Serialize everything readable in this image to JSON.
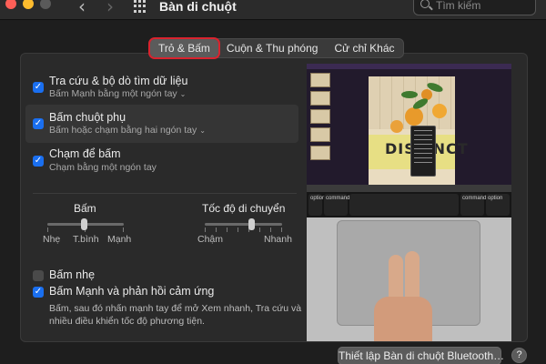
{
  "window": {
    "title": "Bàn di chuột",
    "back_icon": "‹",
    "forward_icon": "›"
  },
  "search": {
    "placeholder": "Tìm kiếm"
  },
  "tabs": [
    {
      "label": "Trỏ & Bấm",
      "active": true
    },
    {
      "label": "Cuộn & Thu phóng",
      "active": false
    },
    {
      "label": "Cử chỉ Khác",
      "active": false
    }
  ],
  "options": [
    {
      "label": "Tra cứu & bộ dò tìm dữ liệu",
      "sub": "Bấm Mạnh bằng một ngón tay",
      "has_menu": true,
      "checked": true
    },
    {
      "label": "Bấm chuột phụ",
      "sub": "Bấm hoặc chạm bằng hai ngón tay",
      "has_menu": true,
      "checked": true
    },
    {
      "label": "Chạm để bấm",
      "sub": "Chạm bằng một ngón tay",
      "has_menu": false,
      "checked": true
    }
  ],
  "sliders": {
    "click": {
      "title": "Bấm",
      "labels": [
        "Nhẹ",
        "T.bình",
        "Mạnh"
      ],
      "value_index": 1
    },
    "tracking": {
      "title": "Tốc độ di chuyển",
      "labels": [
        "Chậm",
        "Nhanh"
      ]
    }
  },
  "bottom_options": [
    {
      "label": "Bấm nhẹ",
      "checked": false
    },
    {
      "label": "Bấm Mạnh và phản hồi cảm ứng",
      "checked": true
    }
  ],
  "description": "Bấm, sau đó nhấn mạnh tay để mở Xem nhanh, Tra cứu và nhiều điều khiển tốc độ phương tiện.",
  "preview": {
    "slide_text": "DISTINCT",
    "keys": [
      "option",
      "command",
      "command",
      "option"
    ]
  },
  "buttons": {
    "bluetooth": "Thiết lập Bàn di chuột Bluetooth…",
    "help": "?"
  },
  "colors": {
    "accent": "#1a6ff0",
    "tab_highlight": "#d9232e",
    "window_bg": "#1e1e1e"
  },
  "checkmark": "✓"
}
